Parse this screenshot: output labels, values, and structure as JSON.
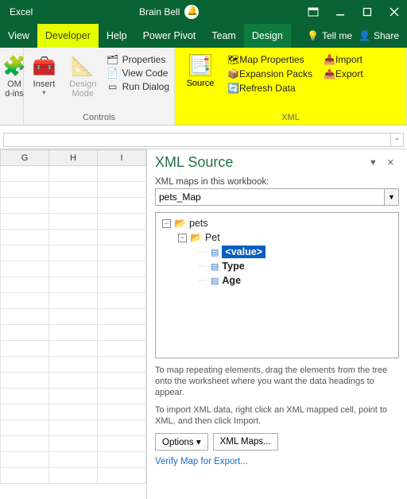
{
  "titlebar": {
    "app": "Excel",
    "user": "Brain Bell"
  },
  "menubar": {
    "tabs": [
      "View",
      "Developer",
      "Help",
      "Power Pivot",
      "Team",
      "Design"
    ],
    "tellme": "Tell me",
    "share": "Share"
  },
  "ribbon": {
    "addins": {
      "label1": "OM",
      "label2": "d-ins"
    },
    "insert": "Insert",
    "design": "Design\nMode",
    "props": "Properties",
    "viewcode": "View Code",
    "rundlg": "Run Dialog",
    "controls_group": "Controls",
    "source": "Source",
    "mapprops": "Map Properties",
    "expansion": "Expansion Packs",
    "refresh": "Refresh Data",
    "import": "Import",
    "export": "Export",
    "xml_group": "XML"
  },
  "sheet": {
    "cols": [
      "G",
      "H",
      "I"
    ]
  },
  "pane": {
    "title": "XML Source",
    "mapslabel": "XML maps in this workbook:",
    "mapname": "pets_Map",
    "tree": {
      "root": "pets",
      "child": "Pet",
      "n1": "<value>",
      "n2": "Type",
      "n3": "Age"
    },
    "hint1": "To map repeating elements, drag the elements from the tree onto the worksheet where you want the data headings to appear.",
    "hint2": "To import XML data, right click an XML mapped cell, point to XML, and then click Import.",
    "options": "Options ▾",
    "xmlmaps": "XML Maps...",
    "verify": "Verify Map for Export..."
  }
}
